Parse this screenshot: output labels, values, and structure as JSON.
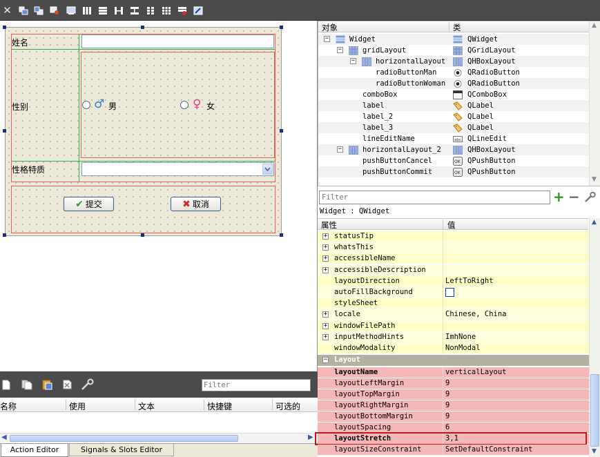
{
  "form": {
    "name_label": "姓名",
    "gender_label": "性别",
    "male_text": "男",
    "female_text": "女",
    "trait_label": "性格特质",
    "submit_label": "提交",
    "cancel_label": "取消"
  },
  "action_editor": {
    "filter_placeholder": "Filter",
    "columns": [
      "名称",
      "使用",
      "文本",
      "快捷键",
      "可选的"
    ],
    "tabs": [
      "Action Editor",
      "Signals & Slots Editor"
    ]
  },
  "object_inspector": {
    "columns": [
      "对象",
      "类"
    ],
    "rows": [
      {
        "name": "Widget",
        "cls": "QWidget"
      },
      {
        "name": "gridLayout",
        "cls": "QGridLayout"
      },
      {
        "name": "horizontalLayout",
        "cls": "QHBoxLayout"
      },
      {
        "name": "radioButtonMan",
        "cls": "QRadioButton"
      },
      {
        "name": "radioButtonWoman",
        "cls": "QRadioButton"
      },
      {
        "name": "comboBox",
        "cls": "QComboBox"
      },
      {
        "name": "label",
        "cls": "QLabel"
      },
      {
        "name": "label_2",
        "cls": "QLabel"
      },
      {
        "name": "label_3",
        "cls": "QLabel"
      },
      {
        "name": "lineEditName",
        "cls": "QLineEdit"
      },
      {
        "name": "horizontalLayout_2",
        "cls": "QHBoxLayout"
      },
      {
        "name": "pushButtonCancel",
        "cls": "QPushButton"
      },
      {
        "name": "pushButtonCommit",
        "cls": "QPushButton"
      }
    ]
  },
  "property_editor": {
    "filter_placeholder": "Filter",
    "object_title": "Widget : QWidget",
    "columns": [
      "属性",
      "值"
    ],
    "rows": [
      {
        "name": "statusTip",
        "value": "",
        "expand": true
      },
      {
        "name": "whatsThis",
        "value": "",
        "expand": true
      },
      {
        "name": "accessibleName",
        "value": "",
        "expand": true
      },
      {
        "name": "accessibleDescription",
        "value": "",
        "expand": true
      },
      {
        "name": "layoutDirection",
        "value": "LeftToRight",
        "expand": false
      },
      {
        "name": "autoFillBackground",
        "value": "",
        "expand": false,
        "checkbox": true
      },
      {
        "name": "styleSheet",
        "value": "",
        "expand": false
      },
      {
        "name": "locale",
        "value": "Chinese, China",
        "expand": true
      },
      {
        "name": "windowFilePath",
        "value": "",
        "expand": true
      },
      {
        "name": "inputMethodHints",
        "value": "ImhNone",
        "expand": true
      },
      {
        "name": "windowModality",
        "value": "NonModal",
        "expand": false
      }
    ],
    "section_label": "Layout",
    "layout_rows": [
      {
        "name": "layoutName",
        "value": "verticalLayout",
        "bold": true
      },
      {
        "name": "layoutLeftMargin",
        "value": "9"
      },
      {
        "name": "layoutTopMargin",
        "value": "9"
      },
      {
        "name": "layoutRightMargin",
        "value": "9"
      },
      {
        "name": "layoutBottomMargin",
        "value": "9"
      },
      {
        "name": "layoutSpacing",
        "value": "6"
      },
      {
        "name": "layoutStretch",
        "value": "3,1",
        "bold": true,
        "highlight": true
      },
      {
        "name": "layoutSizeConstraint",
        "value": "SetDefaultConstraint"
      }
    ]
  },
  "colors": {
    "yellow_row": "#ffffc8",
    "yellow_row_alt": "#ffffdc",
    "section_bg": "#b5b0a0",
    "layout_row": "#f5b8b8",
    "highlight_border": "#c01818"
  }
}
